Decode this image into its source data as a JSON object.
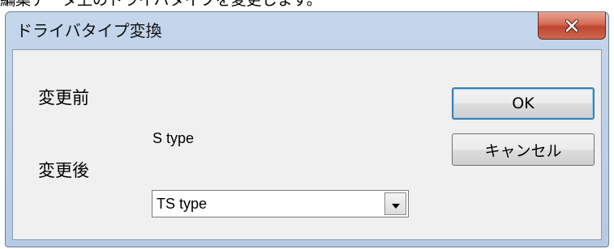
{
  "background": {
    "caption": "編集データ上のドライバタイプを変更します。"
  },
  "window": {
    "title": "ドライバタイプ変換",
    "close_glyph": "X"
  },
  "form": {
    "before_label": "変更前",
    "before_value": "S type",
    "after_label": "変更後",
    "after_select": {
      "selected": "TS type"
    }
  },
  "buttons": {
    "ok_label": "OK",
    "cancel_label": "キャンセル"
  },
  "colors": {
    "frame": "#b9cde5",
    "client": "#f0f0f0",
    "close_button": "#c9523b",
    "default_button_border": "#3c7fb1"
  },
  "icons": {
    "close": "close-icon",
    "dropdown": "chevron-down-icon"
  }
}
